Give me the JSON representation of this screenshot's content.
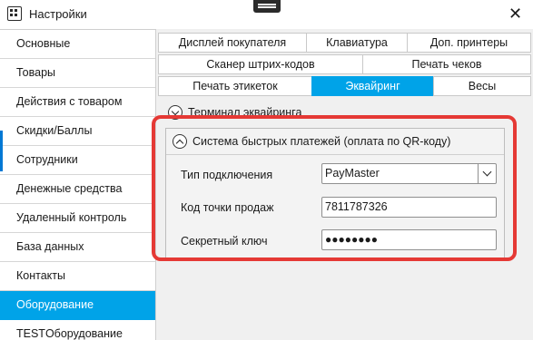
{
  "window": {
    "title": "Настройки",
    "close_glyph": "✕"
  },
  "sidebar": {
    "items": [
      {
        "label": "Основные",
        "active": false
      },
      {
        "label": "Товары",
        "active": false
      },
      {
        "label": "Действия с товаром",
        "active": false
      },
      {
        "label": "Скидки/Баллы",
        "active": false
      },
      {
        "label": "Сотрудники",
        "active": false
      },
      {
        "label": "Денежные средства",
        "active": false
      },
      {
        "label": "Удаленный контроль",
        "active": false
      },
      {
        "label": "База данных",
        "active": false
      },
      {
        "label": "Контакты",
        "active": false
      },
      {
        "label": "Оборудование",
        "active": true
      },
      {
        "label": "TESTОборудование",
        "active": false
      }
    ]
  },
  "tabs": {
    "row1": [
      "Дисплей покупателя",
      "Клавиатура",
      "Доп. принтеры"
    ],
    "row2": [
      "Сканер штрих-кодов",
      "Печать чеков"
    ],
    "row3": [
      "Печать этикеток",
      "Эквайринг",
      "Весы"
    ],
    "active": "Эквайринг"
  },
  "terminal_section": {
    "label": "Терминал эквайринга"
  },
  "sbp_section": {
    "label": "Система быстрых платежей (оплата по QR-коду)",
    "connection_type_label": "Тип подключения",
    "connection_type_value": "PayMaster",
    "point_code_label": "Код точки продаж",
    "point_code_value": "7811787326",
    "secret_key_label": "Секретный ключ",
    "secret_key_value": "●●●●●●●●"
  },
  "colors": {
    "accent": "#00a3e8",
    "highlight": "#e53935"
  }
}
